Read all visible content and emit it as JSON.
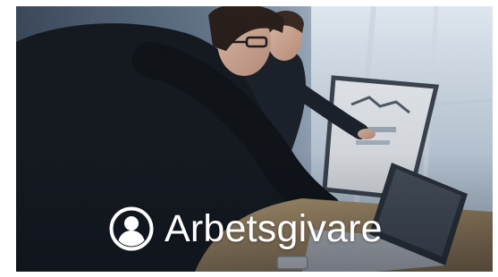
{
  "card": {
    "label": "Arbetsgivare",
    "icon": "user-circle-icon",
    "image": "office-meeting-photo"
  },
  "colors": {
    "label_text": "#ffffff",
    "photo_tint": "#b9cde0"
  }
}
